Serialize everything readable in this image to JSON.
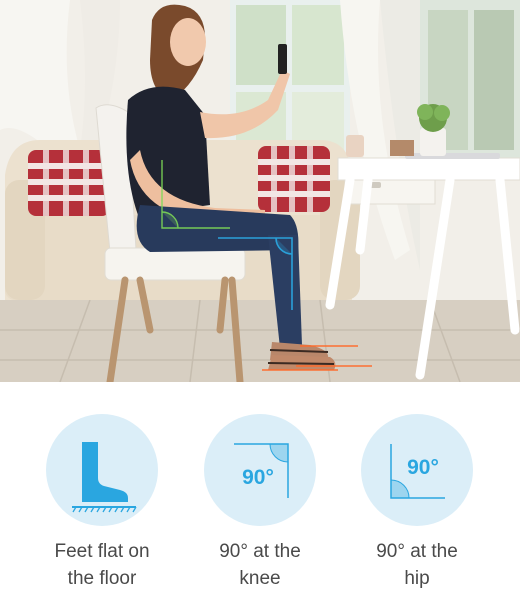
{
  "items": [
    {
      "icon": "foot-on-floor-icon",
      "caption_line1": "Feet flat on",
      "caption_line2": "the floor"
    },
    {
      "icon": "knee-angle-icon",
      "angle_label": "90°",
      "caption_line1": "90° at the",
      "caption_line2": "knee"
    },
    {
      "icon": "hip-angle-icon",
      "angle_label": "90°",
      "caption_line1": "90° at the",
      "caption_line2": "hip"
    }
  ],
  "colors": {
    "accent_blue": "#2aa6e0",
    "badge_background": "#dbeef8",
    "guide_green": "#7ed957",
    "guide_orange": "#ff6a2a",
    "caption_text": "#4a4a4a"
  }
}
